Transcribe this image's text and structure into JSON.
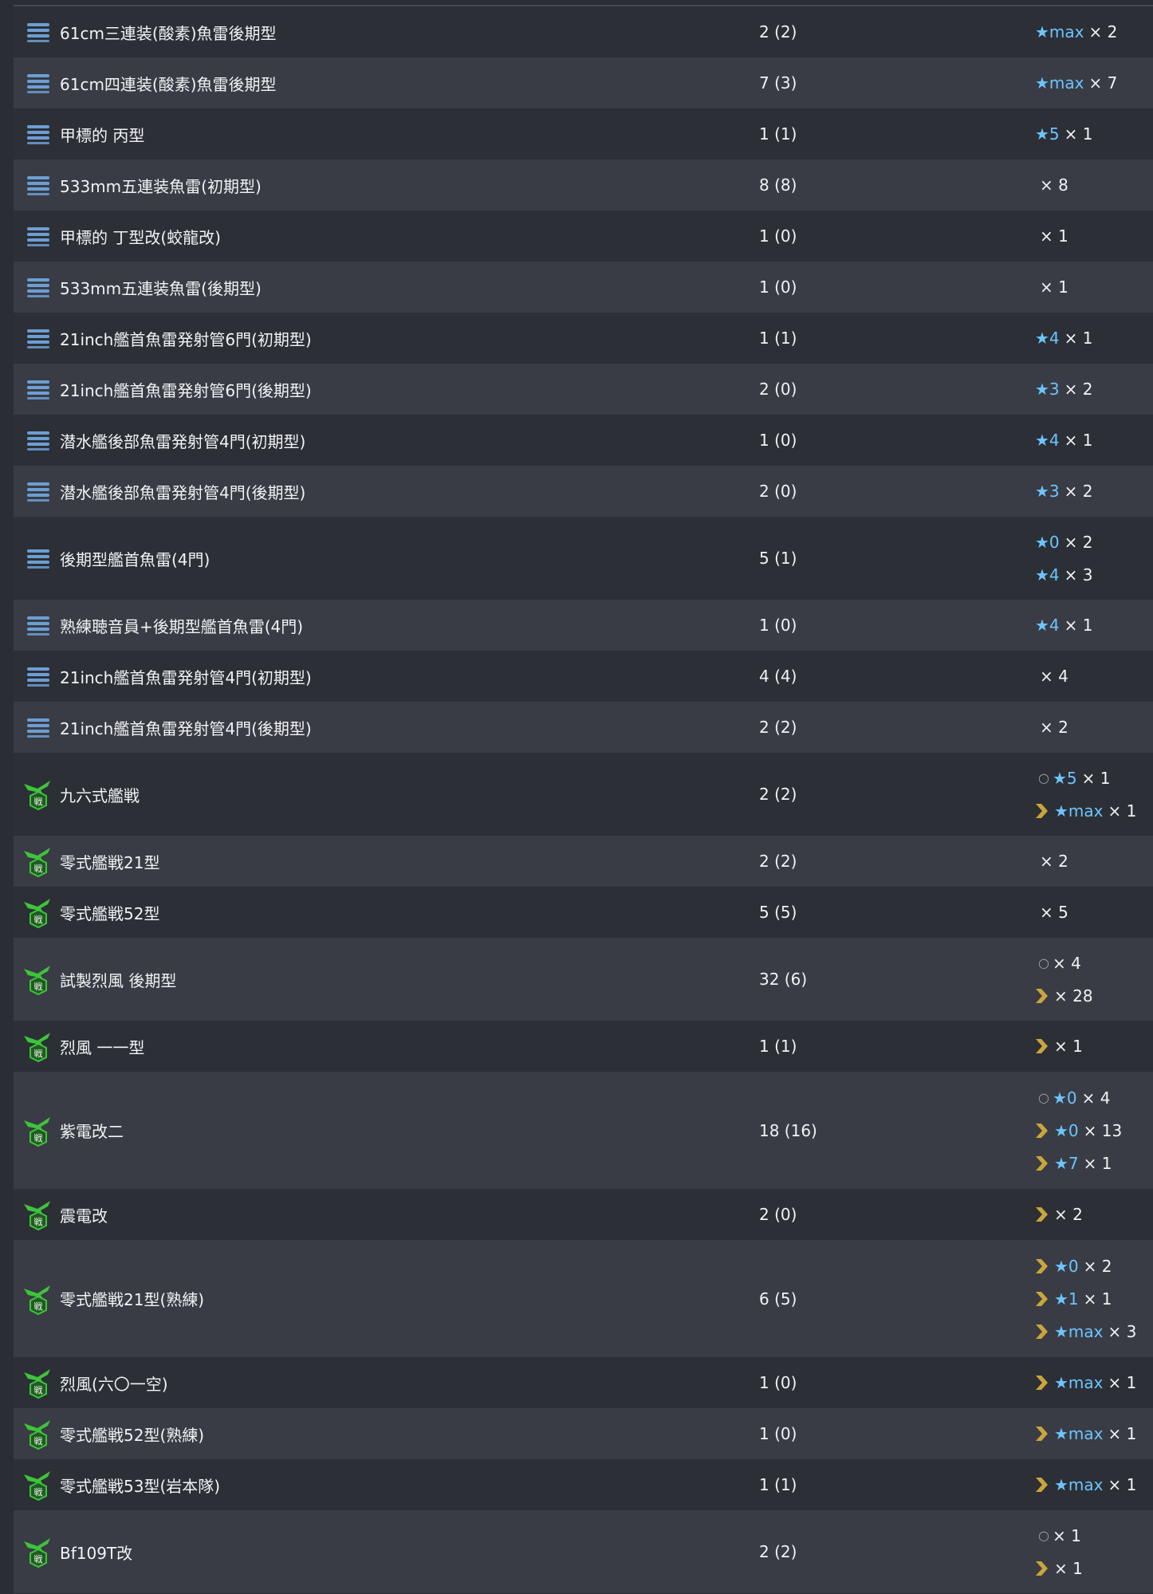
{
  "colors": {
    "row_dark": "#2c2f36",
    "row_light": "#393c44",
    "star": "#6cc5ff",
    "chevron": "#c9a53c",
    "torpedo_icon": "#6d9ed4",
    "fighter_icon": "#3ec43a"
  },
  "rows": [
    {
      "icon": "torpedo-icon",
      "name": "61cm三連装(酸素)魚雷後期型",
      "count": "2 (2)",
      "details": [
        {
          "mark": "none",
          "star": "★max",
          "qty": "× 2"
        }
      ]
    },
    {
      "icon": "torpedo-icon",
      "name": "61cm四連装(酸素)魚雷後期型",
      "count": "7 (3)",
      "details": [
        {
          "mark": "none",
          "star": "★max",
          "qty": "× 7"
        }
      ]
    },
    {
      "icon": "torpedo-icon",
      "name": "甲標的 丙型",
      "count": "1 (1)",
      "details": [
        {
          "mark": "none",
          "star": "★5",
          "qty": "× 1"
        }
      ]
    },
    {
      "icon": "torpedo-icon",
      "name": "533mm五連装魚雷(初期型)",
      "count": "8 (8)",
      "details": [
        {
          "mark": "none",
          "star": "",
          "qty": "× 8"
        }
      ]
    },
    {
      "icon": "torpedo-icon",
      "name": "甲標的 丁型改(蛟龍改)",
      "count": "1 (0)",
      "details": [
        {
          "mark": "none",
          "star": "",
          "qty": "× 1"
        }
      ]
    },
    {
      "icon": "torpedo-icon",
      "name": "533mm五連装魚雷(後期型)",
      "count": "1 (0)",
      "details": [
        {
          "mark": "none",
          "star": "",
          "qty": "× 1"
        }
      ]
    },
    {
      "icon": "torpedo-icon",
      "name": "21inch艦首魚雷発射管6門(初期型)",
      "count": "1 (1)",
      "details": [
        {
          "mark": "none",
          "star": "★4",
          "qty": "× 1"
        }
      ]
    },
    {
      "icon": "torpedo-icon",
      "name": "21inch艦首魚雷発射管6門(後期型)",
      "count": "2 (0)",
      "details": [
        {
          "mark": "none",
          "star": "★3",
          "qty": "× 2"
        }
      ]
    },
    {
      "icon": "torpedo-icon",
      "name": "潜水艦後部魚雷発射管4門(初期型)",
      "count": "1 (0)",
      "details": [
        {
          "mark": "none",
          "star": "★4",
          "qty": "× 1"
        }
      ]
    },
    {
      "icon": "torpedo-icon",
      "name": "潜水艦後部魚雷発射管4門(後期型)",
      "count": "2 (0)",
      "details": [
        {
          "mark": "none",
          "star": "★3",
          "qty": "× 2"
        }
      ]
    },
    {
      "icon": "torpedo-icon",
      "name": "後期型艦首魚雷(4門)",
      "count": "5 (1)",
      "details": [
        {
          "mark": "none",
          "star": "★0",
          "qty": "× 2"
        },
        {
          "mark": "none",
          "star": "★4",
          "qty": "× 3"
        }
      ]
    },
    {
      "icon": "torpedo-icon",
      "name": "熟練聴音員+後期型艦首魚雷(4門)",
      "count": "1 (0)",
      "details": [
        {
          "mark": "none",
          "star": "★4",
          "qty": "× 1"
        }
      ]
    },
    {
      "icon": "torpedo-icon",
      "name": "21inch艦首魚雷発射管4門(初期型)",
      "count": "4 (4)",
      "details": [
        {
          "mark": "none",
          "star": "",
          "qty": "× 4"
        }
      ]
    },
    {
      "icon": "torpedo-icon",
      "name": "21inch艦首魚雷発射管4門(後期型)",
      "count": "2 (2)",
      "details": [
        {
          "mark": "none",
          "star": "",
          "qty": "× 2"
        }
      ]
    },
    {
      "icon": "fighter-icon",
      "name": "九六式艦戦",
      "count": "2 (2)",
      "details": [
        {
          "mark": "circle",
          "star": "★5",
          "qty": "× 1"
        },
        {
          "mark": "chevron",
          "star": "★max",
          "qty": "× 1"
        }
      ]
    },
    {
      "icon": "fighter-icon",
      "name": "零式艦戦21型",
      "count": "2 (2)",
      "details": [
        {
          "mark": "none",
          "star": "",
          "qty": "× 2"
        }
      ]
    },
    {
      "icon": "fighter-icon",
      "name": "零式艦戦52型",
      "count": "5 (5)",
      "details": [
        {
          "mark": "none",
          "star": "",
          "qty": "× 5"
        }
      ]
    },
    {
      "icon": "fighter-icon",
      "name": "試製烈風 後期型",
      "count": "32 (6)",
      "details": [
        {
          "mark": "circle",
          "star": "",
          "qty": "× 4"
        },
        {
          "mark": "chevron",
          "star": "",
          "qty": "× 28"
        }
      ]
    },
    {
      "icon": "fighter-icon",
      "name": "烈風 一一型",
      "count": "1 (1)",
      "details": [
        {
          "mark": "chevron",
          "star": "",
          "qty": "× 1"
        }
      ]
    },
    {
      "icon": "fighter-icon",
      "name": "紫電改二",
      "count": "18 (16)",
      "details": [
        {
          "mark": "circle",
          "star": "★0",
          "qty": "× 4"
        },
        {
          "mark": "chevron",
          "star": "★0",
          "qty": "× 13"
        },
        {
          "mark": "chevron",
          "star": "★7",
          "qty": "× 1"
        }
      ]
    },
    {
      "icon": "fighter-icon",
      "name": "震電改",
      "count": "2 (0)",
      "details": [
        {
          "mark": "chevron",
          "star": "",
          "qty": "× 2"
        }
      ]
    },
    {
      "icon": "fighter-icon",
      "name": "零式艦戦21型(熟練)",
      "count": "6 (5)",
      "details": [
        {
          "mark": "chevron",
          "star": "★0",
          "qty": "× 2"
        },
        {
          "mark": "chevron",
          "star": "★1",
          "qty": "× 1"
        },
        {
          "mark": "chevron",
          "star": "★max",
          "qty": "× 3"
        }
      ]
    },
    {
      "icon": "fighter-icon",
      "name": "烈風(六〇一空)",
      "count": "1 (0)",
      "details": [
        {
          "mark": "chevron",
          "star": "★max",
          "qty": "× 1"
        }
      ]
    },
    {
      "icon": "fighter-icon",
      "name": "零式艦戦52型(熟練)",
      "count": "1 (0)",
      "details": [
        {
          "mark": "chevron",
          "star": "★max",
          "qty": "× 1"
        }
      ]
    },
    {
      "icon": "fighter-icon",
      "name": "零式艦戦53型(岩本隊)",
      "count": "1 (1)",
      "details": [
        {
          "mark": "chevron",
          "star": "★max",
          "qty": "× 1"
        }
      ]
    },
    {
      "icon": "fighter-icon",
      "name": "Bf109T改",
      "count": "2 (2)",
      "details": [
        {
          "mark": "circle",
          "star": "",
          "qty": "× 1"
        },
        {
          "mark": "chevron",
          "star": "",
          "qty": "× 1"
        }
      ]
    }
  ]
}
